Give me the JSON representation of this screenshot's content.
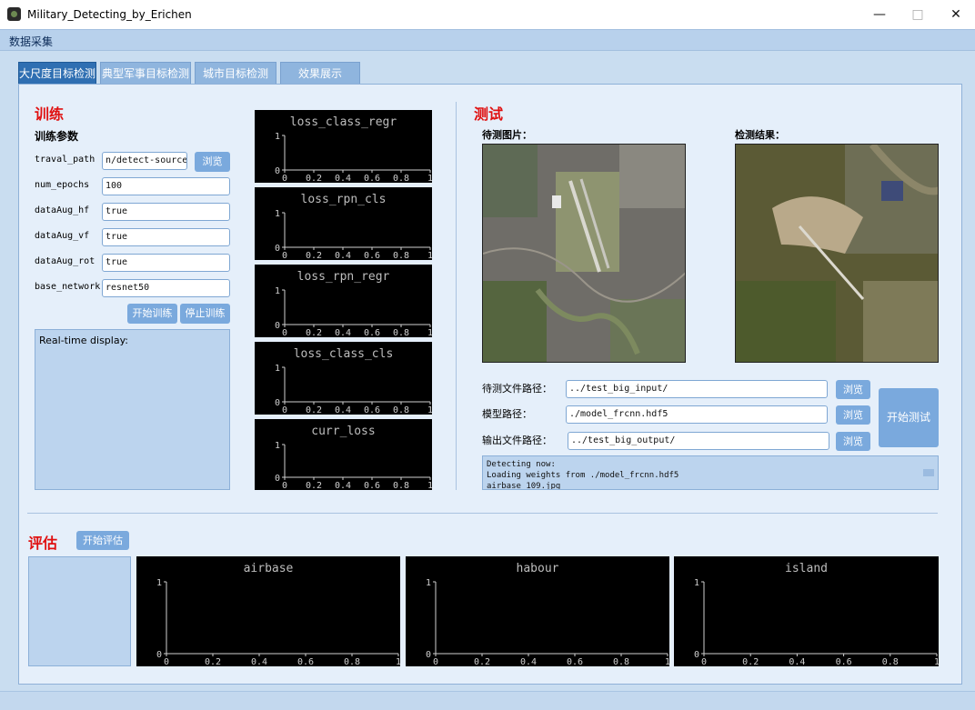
{
  "window": {
    "title": "Military_Detecting_by_Erichen",
    "minimize": "—",
    "maximize": "□",
    "close": "✕"
  },
  "menu": {
    "data_collect": "数据采集"
  },
  "tabs": [
    "大尺度目标检测",
    "典型军事目标检测",
    "城市目标检测",
    "效果展示"
  ],
  "train": {
    "title": "训练",
    "params_title": "训练参数",
    "fields": [
      {
        "label": "traval_path",
        "value": "n/detect-source/"
      },
      {
        "label": "num_epochs",
        "value": "100"
      },
      {
        "label": "dataAug_hf",
        "value": "true"
      },
      {
        "label": "dataAug_vf",
        "value": "true"
      },
      {
        "label": "dataAug_rot",
        "value": "true"
      },
      {
        "label": "base_network",
        "value": "resnet50"
      }
    ],
    "browse": "浏览",
    "start": "开始训练",
    "stop": "停止训练",
    "display": "Real-time display:"
  },
  "loss_charts": [
    {
      "title": "loss_class_regr"
    },
    {
      "title": "loss_rpn_cls"
    },
    {
      "title": "loss_rpn_regr"
    },
    {
      "title": "loss_class_cls"
    },
    {
      "title": "curr_loss"
    }
  ],
  "axis_ticks": {
    "x": [
      "0",
      "0.2",
      "0.4",
      "0.6",
      "0.8",
      "1"
    ],
    "y": [
      "0",
      "1"
    ]
  },
  "test": {
    "title": "测试",
    "input_img_label": "待测图片：",
    "result_img_label": "检测结果：",
    "paths": [
      {
        "label": "待测文件路径：",
        "value": "../test_big_input/",
        "browse": "浏览"
      },
      {
        "label": "模型路径：",
        "value": "./model_frcnn.hdf5",
        "browse": "浏览"
      },
      {
        "label": "输出文件路径：",
        "value": "../test_big_output/",
        "browse": "浏览"
      }
    ],
    "start": "开始测试",
    "log": [
      "Detecting now:",
      "Loading weights from ./model_frcnn.hdf5",
      "airbase_109.jpg"
    ]
  },
  "eval": {
    "title": "评估",
    "start": "开始评估",
    "charts": [
      {
        "title": "airbase"
      },
      {
        "title": "habour"
      },
      {
        "title": "island"
      }
    ]
  },
  "colors": {
    "title_red": "#e01010",
    "tab_active": "#2f6fb2",
    "button": "#7aa9dd",
    "panel": "#e5effa"
  }
}
